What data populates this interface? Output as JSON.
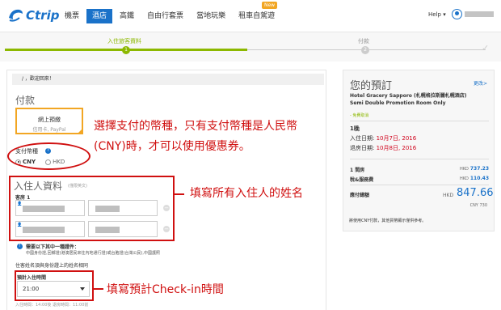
{
  "brand": {
    "name": "Ctrip",
    "color": "#1a72c9"
  },
  "nav": {
    "items": [
      "機票",
      "酒店",
      "高鐵",
      "自由行套票",
      "當地玩樂",
      "租車自駕遊"
    ],
    "active_index": 1,
    "new_badge": "New",
    "help": "Help"
  },
  "progress": {
    "step1_label": "入住旅客資料",
    "step1_num": "1",
    "step2_label": "付款",
    "step2_num": "2",
    "current_step": 1
  },
  "welcome": "/ ，歡迎回來！",
  "payment": {
    "title": "付款",
    "method_main": "網上預繳",
    "method_sub": "信用卡, PayPal",
    "currency_label": "支付幣種",
    "currency_help": "?",
    "options": [
      "CNY",
      "HKD"
    ],
    "selected": "CNY"
  },
  "guest": {
    "title": "入住人資料",
    "subtitle": "(僅限英文)",
    "room_label": "客房 1"
  },
  "id_info": {
    "title": "需要以下其中一種證件：",
    "text": "中國身份證,回鄉證(港澳居民來往內地通行證)或台胞證(台灣公民),中國護照"
  },
  "name_note": "住客姓名須與身份證上的姓名相同",
  "checkin": {
    "label": "預計入住時間",
    "value": "21:00",
    "note": "入住時間：14:00後 退房時間：11:00前"
  },
  "annotations": {
    "a1": "選擇支付的幣種，只有支付幣種是人民幣(CNY)時，才可以使用優惠券。",
    "a2": "填寫所有入住人的姓名",
    "a3": "填寫預計Check-in時間",
    "color": "#d01010"
  },
  "booking": {
    "title": "您的預訂",
    "more": "更改>",
    "hotel": "Hotel Gracery Sapporo (札幌格拉斯麗札幌酒店)",
    "room": "Semi Double Promotion Room Only",
    "free_cancel": "- 免費取消",
    "nights": "1晚",
    "checkin_label": "入住日期:",
    "checkin_date": "10月7日, 2016",
    "checkout_label": "退房日期:",
    "checkout_date": "10月8日, 2016",
    "rooms_label": "1 間房",
    "rooms_cur": "HKD",
    "rooms_amt": "737.23",
    "tax_label": "稅&服務費",
    "tax_cur": "HKD",
    "tax_amt": "110.43",
    "total_label": "應付總額",
    "total_cur": "HKD",
    "total_amt": "847.66",
    "total_cny": "CNY 730",
    "note": "將使用CNY付款，其他貨幣顯示僅供參考。"
  }
}
